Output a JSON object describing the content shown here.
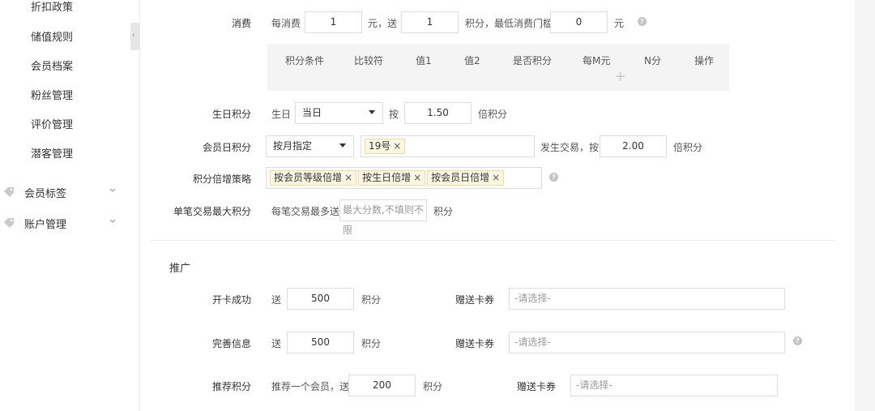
{
  "sidebar": {
    "items": [
      "折扣政策",
      "储值规则",
      "会员档案",
      "粉丝管理",
      "评价管理",
      "潜客管理"
    ],
    "groups": [
      {
        "label": "会员标签",
        "icon": "tag-icon"
      },
      {
        "label": "账户管理",
        "icon": "tag-icon"
      }
    ],
    "collapse_glyph": "‹"
  },
  "consume": {
    "label": "消费",
    "prefix": "每消费",
    "amount": "1",
    "mid": "元，送",
    "points": "1",
    "mid2": "积分，最低消费门槛",
    "threshold": "0",
    "unit": "元"
  },
  "table": {
    "headers": [
      "积分条件",
      "比较符",
      "值1",
      "值2",
      "是否积分",
      "每M元",
      "N分",
      "操作"
    ],
    "add_glyph": "+"
  },
  "birthday": {
    "label": "生日积分",
    "prefix": "生日",
    "select": "当日",
    "mid": "按",
    "multiplier": "1.50",
    "suffix": "倍积分"
  },
  "member_day": {
    "label": "会员日积分",
    "select": "按月指定",
    "tags": [
      "19号"
    ],
    "mid": "发生交易，按",
    "multiplier": "2.00",
    "suffix": "倍积分"
  },
  "strategy": {
    "label": "积分倍增策略",
    "tags": [
      "按会员等级倍增",
      "按生日倍增",
      "按会员日倍增"
    ]
  },
  "max_points": {
    "label": "单笔交易最大积分",
    "prefix": "每笔交易最多送",
    "placeholder": "最大分数,不填则不限",
    "suffix": "积分"
  },
  "promo": {
    "title": "推广",
    "rows": [
      {
        "label": "开卡成功",
        "prefix": "送",
        "value": "500",
        "suffix": "积分",
        "coupon_label": "赠送卡券",
        "coupon_placeholder": "-请选择-"
      },
      {
        "label": "完善信息",
        "prefix": "送",
        "value": "500",
        "suffix": "积分",
        "coupon_label": "赠送卡券",
        "coupon_placeholder": "-请选择-"
      },
      {
        "label": "推荐积分",
        "prefix": "推荐一个会员，送",
        "value": "200",
        "suffix": "积分",
        "coupon_label": "赠送卡券",
        "coupon_placeholder": "-请选择-"
      }
    ]
  },
  "help_glyph": "?",
  "remove_glyph": "×"
}
